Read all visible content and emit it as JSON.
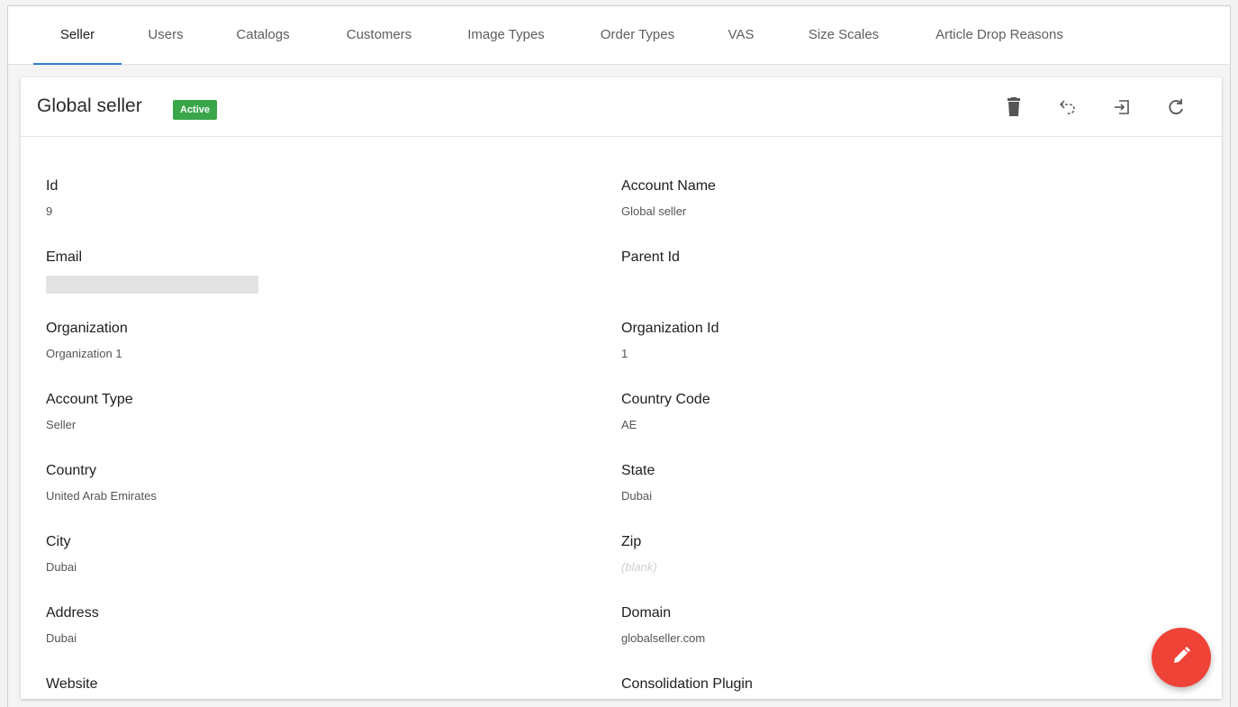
{
  "tabs": [
    {
      "label": "Seller",
      "active": true
    },
    {
      "label": "Users"
    },
    {
      "label": "Catalogs"
    },
    {
      "label": "Customers"
    },
    {
      "label": "Image Types"
    },
    {
      "label": "Order Types"
    },
    {
      "label": "VAS"
    },
    {
      "label": "Size Scales"
    },
    {
      "label": "Article Drop Reasons"
    }
  ],
  "card": {
    "title": "Global seller",
    "status": "Active",
    "status_color": "#3aa64a",
    "actions": [
      {
        "name": "delete-icon"
      },
      {
        "name": "undo-icon"
      },
      {
        "name": "login-icon"
      },
      {
        "name": "refresh-icon"
      }
    ]
  },
  "fields": {
    "id": {
      "label": "Id",
      "value": "9"
    },
    "account_name": {
      "label": "Account Name",
      "value": "Global seller"
    },
    "email": {
      "label": "Email",
      "value": ""
    },
    "parent_id": {
      "label": "Parent Id",
      "value": ""
    },
    "organization": {
      "label": "Organization",
      "value": "Organization 1"
    },
    "organization_id": {
      "label": "Organization Id",
      "value": "1"
    },
    "account_type": {
      "label": "Account Type",
      "value": "Seller"
    },
    "country_code": {
      "label": "Country Code",
      "value": "AE"
    },
    "country": {
      "label": "Country",
      "value": "United Arab Emirates"
    },
    "state": {
      "label": "State",
      "value": "Dubai"
    },
    "city": {
      "label": "City",
      "value": "Dubai"
    },
    "zip": {
      "label": "Zip",
      "value": "(blank)"
    },
    "address": {
      "label": "Address",
      "value": "Dubai"
    },
    "domain": {
      "label": "Domain",
      "value": "globalseller.com"
    },
    "website": {
      "label": "Website",
      "value": ""
    },
    "consolidation_plugin": {
      "label": "Consolidation Plugin",
      "value": ""
    }
  },
  "fab": {
    "icon": "edit-icon",
    "color": "#ef4338"
  }
}
